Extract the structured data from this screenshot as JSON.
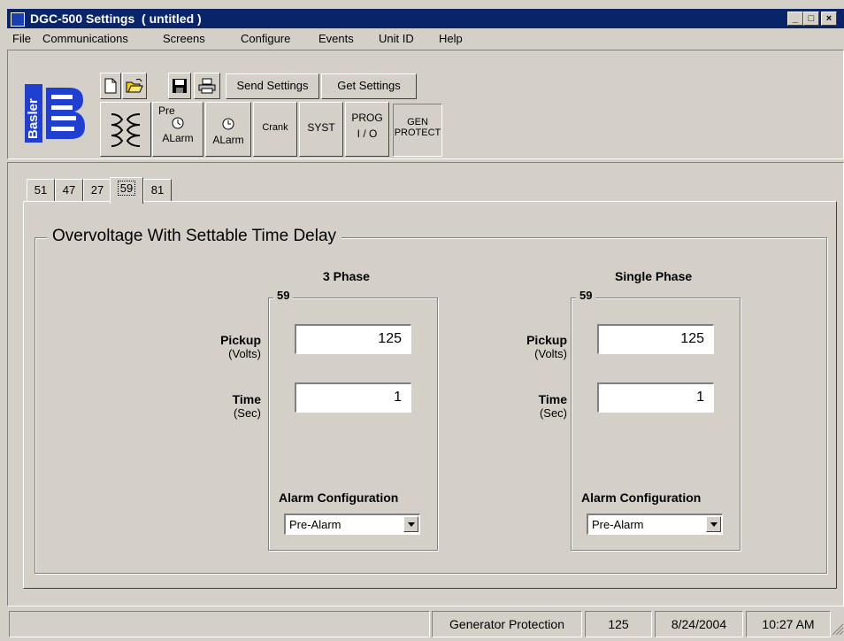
{
  "window": {
    "title": "DGC-500 Settings  ( untitled )",
    "controls": [
      "_",
      "□",
      "×"
    ]
  },
  "menu": [
    "File",
    "Communications",
    "Screens",
    "Configure",
    "Events",
    "Unit ID",
    "Help"
  ],
  "logo": {
    "text": "Basler"
  },
  "toolbar": {
    "send_settings": "Send Settings",
    "get_settings": "Get Settings",
    "icons": [
      "new-file-icon",
      "open-folder-icon",
      "save-disk-icon",
      "print-icon"
    ]
  },
  "screen_buttons": {
    "pre_alarm_top": "Pre",
    "pre_alarm_bottom": "ALarm",
    "alarm": "ALarm",
    "crank": "Crank",
    "syst": "SYST",
    "prog_top": "PROG",
    "prog_bottom": "I / O",
    "gen_top": "GEN",
    "gen_bottom": "PROTECT"
  },
  "tabs": [
    "51",
    "47",
    "27",
    "59",
    "81"
  ],
  "active_tab": "59",
  "group_title": "Overvoltage With Settable Time Delay",
  "three_phase": {
    "heading": "3 Phase",
    "box_title": "59",
    "pickup_label": "Pickup",
    "pickup_unit": "(Volts)",
    "pickup_value": "125",
    "time_label": "Time",
    "time_unit": "(Sec)",
    "time_value": "1",
    "alarm_label": "Alarm Configuration",
    "alarm_value": "Pre-Alarm"
  },
  "single_phase": {
    "heading": "Single Phase",
    "box_title": "59",
    "pickup_label": "Pickup",
    "pickup_unit": "(Volts)",
    "pickup_value": "125",
    "time_label": "Time",
    "time_unit": "(Sec)",
    "time_value": "1",
    "alarm_label": "Alarm Configuration",
    "alarm_value": "Pre-Alarm"
  },
  "status": {
    "screen": "Generator Protection",
    "value": "125",
    "date": "8/24/2004",
    "time": "10:27 AM"
  },
  "colors": {
    "titlebar": "#0a246a",
    "face": "#d4d0c8",
    "logo_blue": "#1f3fd0"
  }
}
